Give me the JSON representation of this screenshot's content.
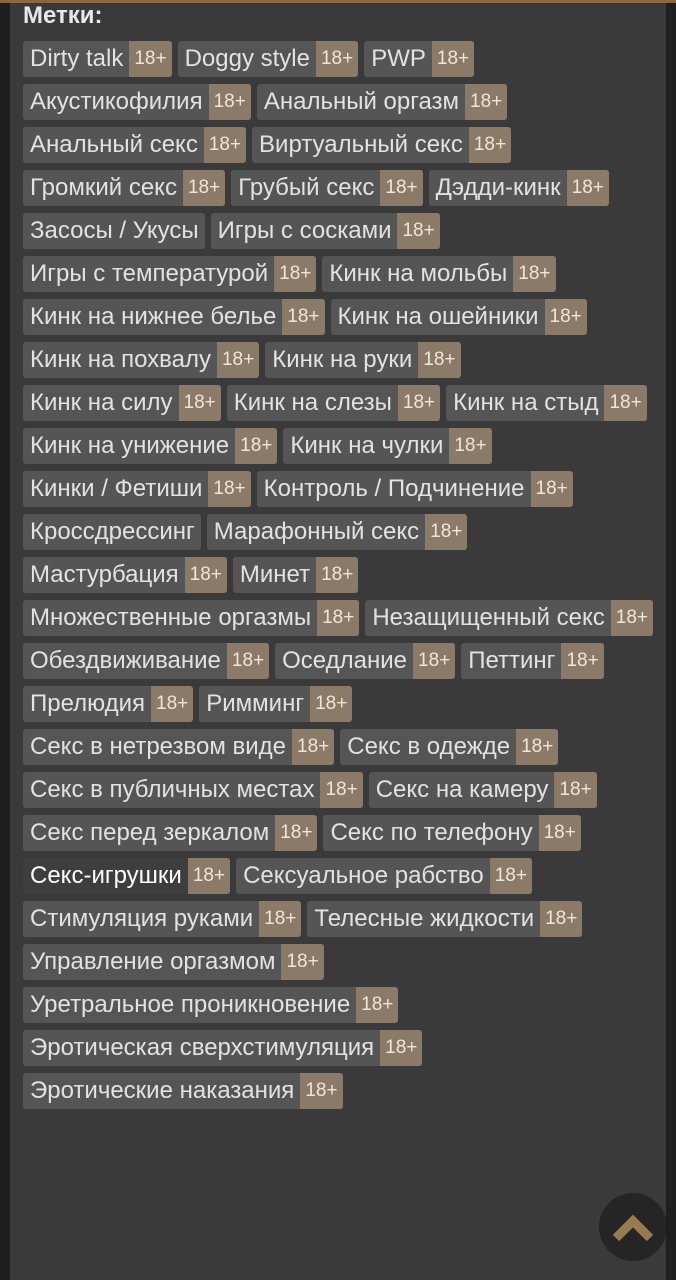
{
  "heading": "Метки:",
  "tags": [
    {
      "name": "Dirty talk",
      "badge": "18+"
    },
    {
      "name": "Doggy style",
      "badge": "18+"
    },
    {
      "name": "PWP",
      "badge": "18+"
    },
    {
      "name": "Акустикофилия",
      "badge": "18+"
    },
    {
      "name": "Анальный оргазм",
      "badge": "18+"
    },
    {
      "name": "Анальный секс",
      "badge": "18+"
    },
    {
      "name": "Виртуальный секс",
      "badge": "18+"
    },
    {
      "name": "Громкий секс",
      "badge": "18+"
    },
    {
      "name": "Грубый секс",
      "badge": "18+"
    },
    {
      "name": "Дэдди-кинк",
      "badge": "18+"
    },
    {
      "name": "Засосы / Укусы",
      "badge": ""
    },
    {
      "name": "Игры с сосками",
      "badge": "18+"
    },
    {
      "name": "Игры с температурой",
      "badge": "18+"
    },
    {
      "name": "Кинк на мольбы",
      "badge": "18+"
    },
    {
      "name": "Кинк на нижнее белье",
      "badge": "18+"
    },
    {
      "name": "Кинк на ошейники",
      "badge": "18+"
    },
    {
      "name": "Кинк на похвалу",
      "badge": "18+"
    },
    {
      "name": "Кинк на руки",
      "badge": "18+"
    },
    {
      "name": "Кинк на силу",
      "badge": "18+"
    },
    {
      "name": "Кинк на слезы",
      "badge": "18+"
    },
    {
      "name": "Кинк на стыд",
      "badge": "18+"
    },
    {
      "name": "Кинк на унижение",
      "badge": "18+"
    },
    {
      "name": "Кинк на чулки",
      "badge": "18+"
    },
    {
      "name": "Кинки / Фетиши",
      "badge": "18+"
    },
    {
      "name": "Контроль / Подчинение",
      "badge": "18+"
    },
    {
      "name": "Кроссдрессинг",
      "badge": ""
    },
    {
      "name": "Марафонный секс",
      "badge": "18+"
    },
    {
      "name": "Мастурбация",
      "badge": "18+"
    },
    {
      "name": "Минет",
      "badge": "18+"
    },
    {
      "name": "Множественные оргазмы",
      "badge": "18+"
    },
    {
      "name": "Незащищенный секс",
      "badge": "18+"
    },
    {
      "name": "Обездвиживание",
      "badge": "18+"
    },
    {
      "name": "Оседлание",
      "badge": "18+"
    },
    {
      "name": "Петтинг",
      "badge": "18+"
    },
    {
      "name": "Прелюдия",
      "badge": "18+"
    },
    {
      "name": "Римминг",
      "badge": "18+"
    },
    {
      "name": "Секс в нетрезвом виде",
      "badge": "18+"
    },
    {
      "name": "Секс в одежде",
      "badge": "18+"
    },
    {
      "name": "Секс в публичных местах",
      "badge": "18+"
    },
    {
      "name": "Секс на камеру",
      "badge": "18+"
    },
    {
      "name": "Секс перед зеркалом",
      "badge": "18+"
    },
    {
      "name": "Секс по телефону",
      "badge": "18+"
    },
    {
      "name": "Секс-игрушки",
      "badge": "18+",
      "highlight": true
    },
    {
      "name": "Сексуальное рабство",
      "badge": "18+"
    },
    {
      "name": "Стимуляция руками",
      "badge": "18+"
    },
    {
      "name": "Телесные жидкости",
      "badge": "18+"
    },
    {
      "name": "Управление оргазмом",
      "badge": "18+"
    },
    {
      "name": "Уретральное проникновение",
      "badge": "18+"
    },
    {
      "name": "Эротическая сверхстимуляция",
      "badge": "18+"
    },
    {
      "name": "Эротические наказания",
      "badge": "18+"
    }
  ],
  "scroll_top_icon": "chevron-up-icon"
}
